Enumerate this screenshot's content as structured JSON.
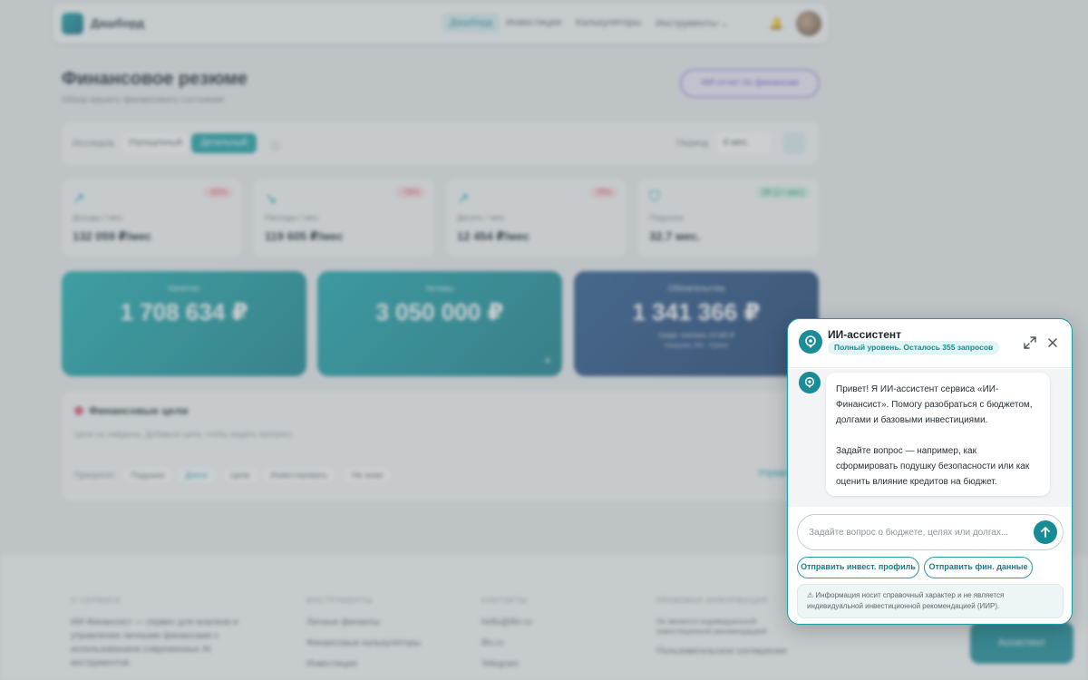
{
  "nav": {
    "brand": "Дашборд",
    "links": [
      "Дашборд",
      "Инвестиции",
      "Калькуляторы",
      "Инструменты"
    ]
  },
  "page": {
    "title": "Финансовое резюме",
    "subtitle": "Обзор вашего финансового состояния",
    "ai_report_button": "ИИ-отчет по финансам"
  },
  "view_bar": {
    "label": "Исследов.",
    "mode_simple": "Упрощенный",
    "mode_detailed": "Детальный",
    "period_label": "Период",
    "period_value": "6 мес."
  },
  "stats": [
    {
      "label": "Доходы / мес",
      "value": "132 059 ₽/мес",
      "badge": "-65%"
    },
    {
      "label": "Расходы / мес",
      "value": "119 605 ₽/мес",
      "badge": "-78%"
    },
    {
      "label": "Десять / мес",
      "value": "12 454 ₽/мес",
      "badge": "78%"
    },
    {
      "label": "Подушка",
      "value": "32.7 мес.",
      "badge": "28 (1+ мес)"
    }
  ],
  "summary": [
    {
      "label": "Капитал",
      "value": "1 708 634 ₽"
    },
    {
      "label": "Активы",
      "value": "3 050 000 ₽"
    },
    {
      "label": "Обязательства",
      "value": "1 341 366 ₽",
      "sub1": "Средн. платежи: 24 580 ₽",
      "sub2": "Нагрузка: 8% · Нужно"
    }
  ],
  "goals": {
    "title": "Финансовые цели",
    "empty_text": "Цели не найдены. Добавьте цели, чтобы видеть прогресс",
    "prefix": "Приоритет:",
    "chips": [
      "Подушка",
      "Долги",
      "Цели",
      "Инвестировать",
      "Не знаю"
    ],
    "manage": "Управлять"
  },
  "footer": {
    "columns": [
      {
        "heading": "О СЕРВИСЕ",
        "items": [
          "ИИ-Финансист — сервис для анализа и",
          "управления личными финансами с",
          "использованием современных AI",
          "инструментов"
        ]
      },
      {
        "heading": "ИНСТРУМЕНТЫ",
        "items": [
          "Личные финансы",
          "Финансовые калькуляторы",
          "Инвестиции"
        ]
      },
      {
        "heading": "КОНТАКТЫ",
        "items": [
          "hello@ifin.ru",
          "ifin.ru",
          "Telegram"
        ]
      },
      {
        "heading": "ПРАВОВАЯ ИНФОРМАЦИЯ",
        "items": [
          "Не является индивидуальной",
          "инвестиционной рекомендацией",
          "Пользовательское соглашение"
        ]
      }
    ],
    "fab": "Ассистент"
  },
  "chat": {
    "title": "ИИ-ассистент",
    "quota": "Полный уровень. Осталось 355 запросов",
    "greeting_p1": "Привет! Я ИИ-ассистент сервиса «ИИ-Финансист». Помогу разобраться с бюджетом, долгами и базовыми инвестициями.",
    "greeting_p2": "Задайте вопрос — например, как сформировать подушку безопасности или как оценить влияние кредитов на бюджет.",
    "input_placeholder": "Задайте вопрос о бюджете, целях или долгах...",
    "quick_actions": [
      "Отправить инвест. профиль",
      "Отправить фин. данные"
    ],
    "disclaimer": "Информация носит справочный характер и не является индивидуальной инвестиционной рекомендацией (ИИР)."
  },
  "colors": {
    "accent": "#178c95",
    "teal_card": "#19a3a7",
    "navy_card": "#23508a"
  }
}
